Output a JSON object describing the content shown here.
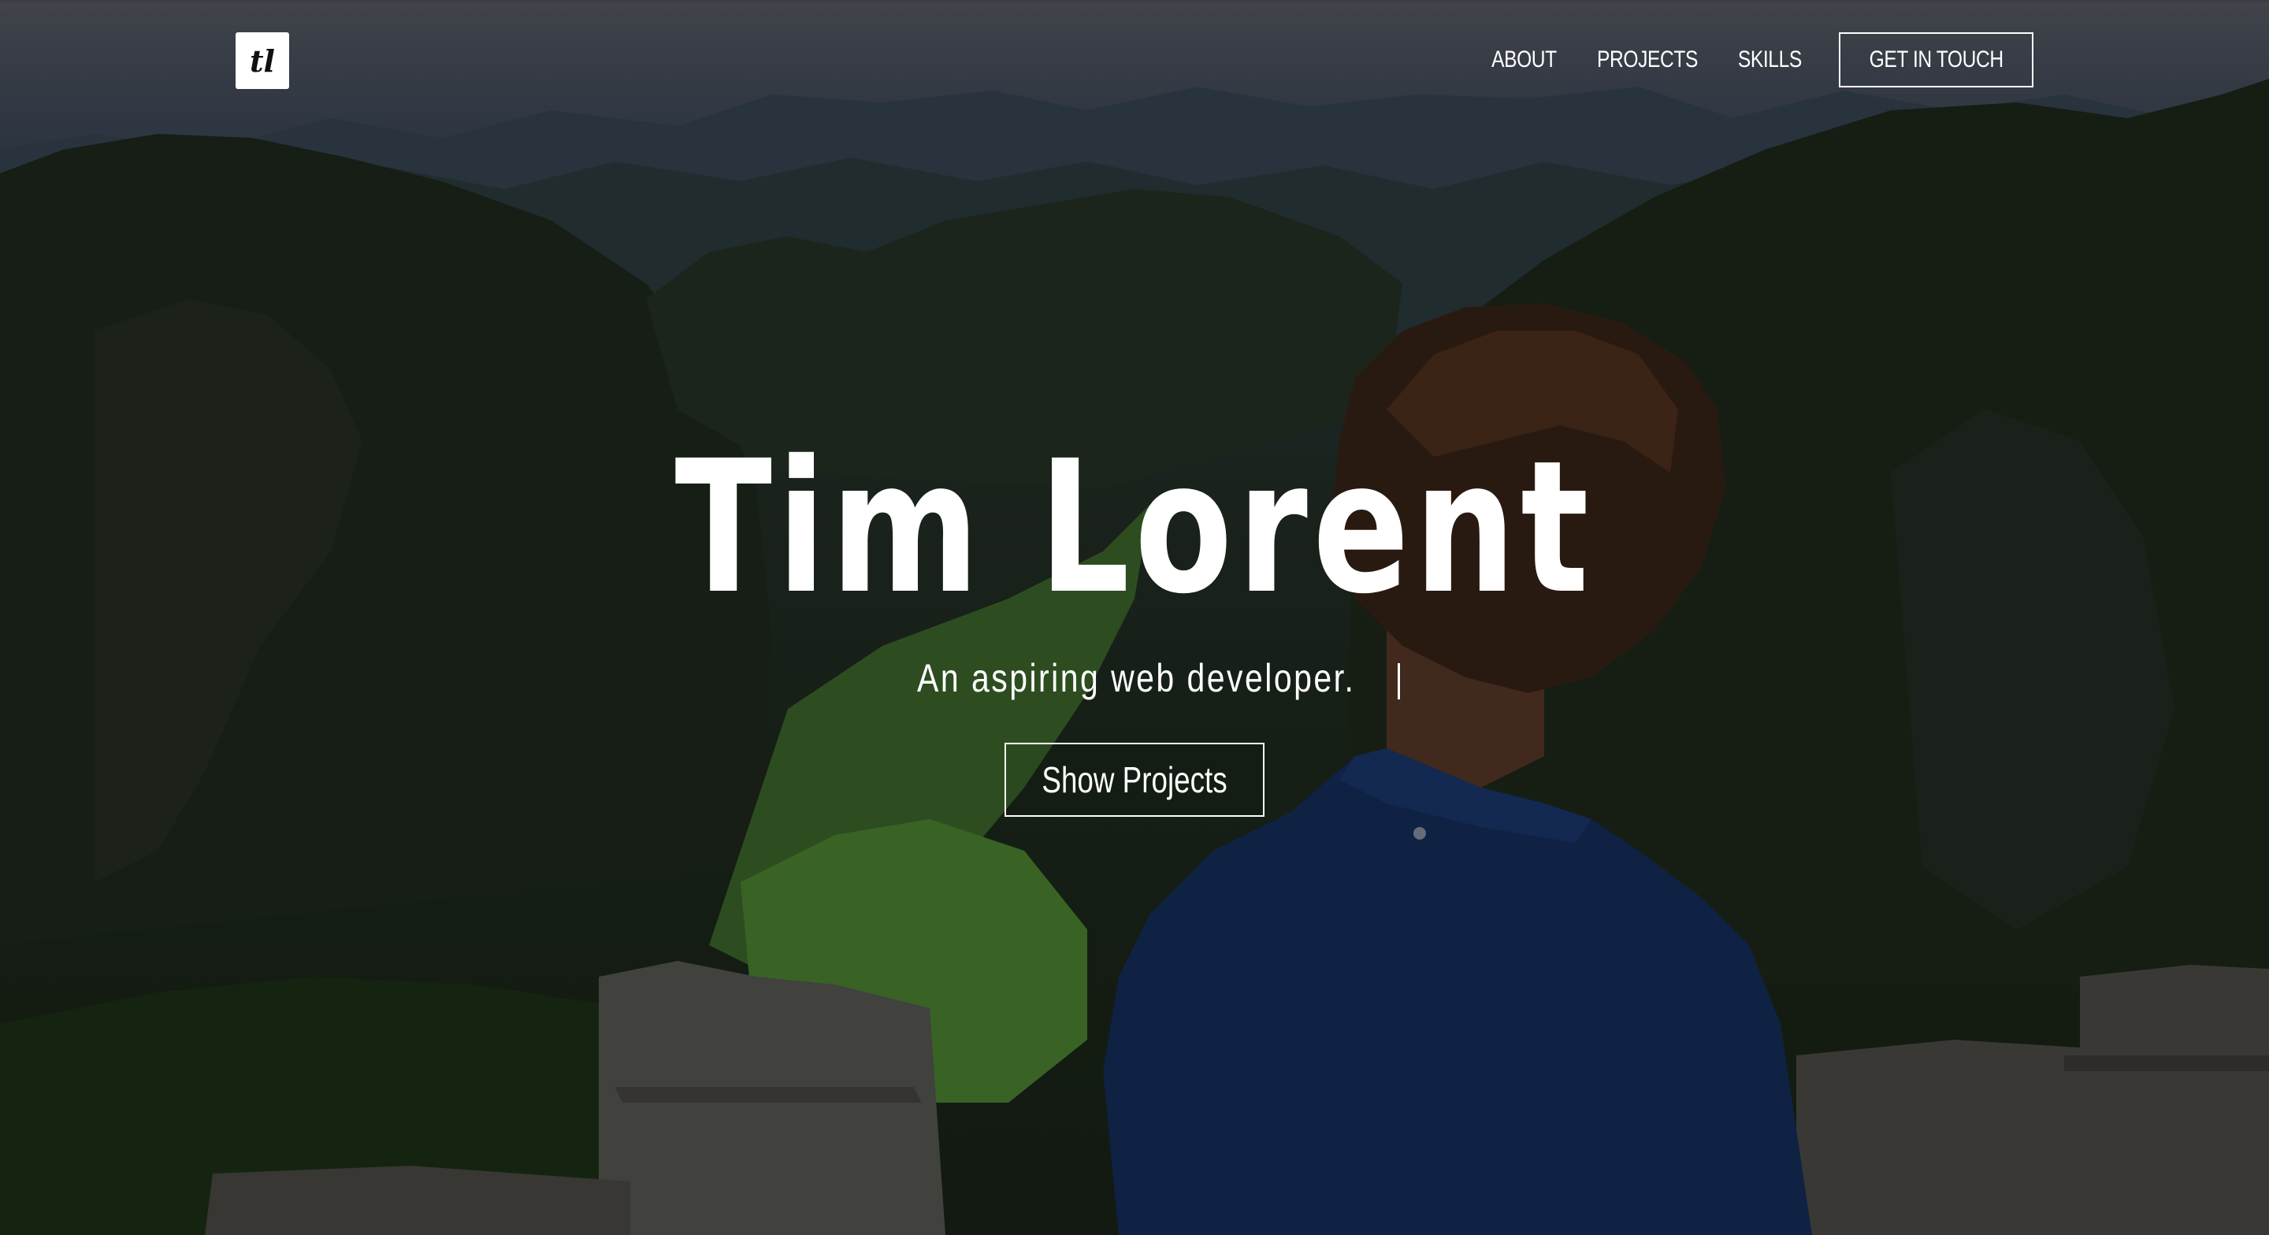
{
  "logo": {
    "text": "tl"
  },
  "nav": {
    "links": [
      "ABOUT",
      "PROJECTS",
      "SKILLS"
    ],
    "cta": "GET IN TOUCH"
  },
  "hero": {
    "title": "Tim Lorent",
    "subtitle": "An aspiring web developer.",
    "button": "Show Projects"
  },
  "colors": {
    "text": "#ffffff",
    "overlay": "rgba(0,0,0,0.28)"
  }
}
